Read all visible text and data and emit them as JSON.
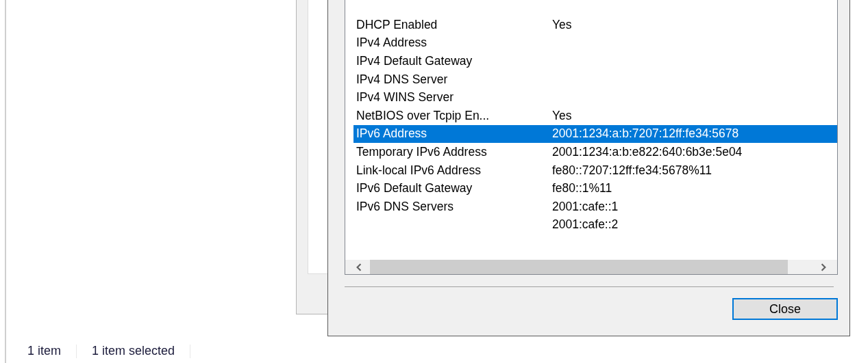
{
  "dialog": {
    "property_list": {
      "rows": [
        {
          "property": "DHCP Enabled",
          "value": "Yes",
          "selected": false
        },
        {
          "property": "IPv4 Address",
          "selected": false
        },
        {
          "property": "IPv4 Default Gateway",
          "selected": false
        },
        {
          "property": "IPv4 DNS Server",
          "selected": false
        },
        {
          "property": "IPv4 WINS Server",
          "selected": false
        },
        {
          "property": "NetBIOS over Tcpip En...",
          "value": "Yes",
          "selected": false
        },
        {
          "property": "IPv6 Address",
          "value": "2001:1234:a:b:7207:12ff:fe34:5678",
          "selected": true
        },
        {
          "property": "Temporary IPv6 Address",
          "value": "2001:1234:a:b:e822:640:6b3e:5e04",
          "selected": false
        },
        {
          "property": "Link-local IPv6 Address",
          "value": "fe80::7207:12ff:fe34:5678%11",
          "selected": false
        },
        {
          "property": "IPv6 Default Gateway",
          "value": "fe80::1%11",
          "selected": false
        },
        {
          "property": "IPv6 DNS Servers",
          "value": "2001:cafe::1",
          "selected": false
        },
        {
          "value": "2001:cafe::2",
          "selected": false
        }
      ]
    },
    "buttons": [
      {
        "label": "Close",
        "focused": true
      }
    ]
  },
  "status_bar": {
    "item_count": "1 item",
    "selection": "1 item selected"
  }
}
